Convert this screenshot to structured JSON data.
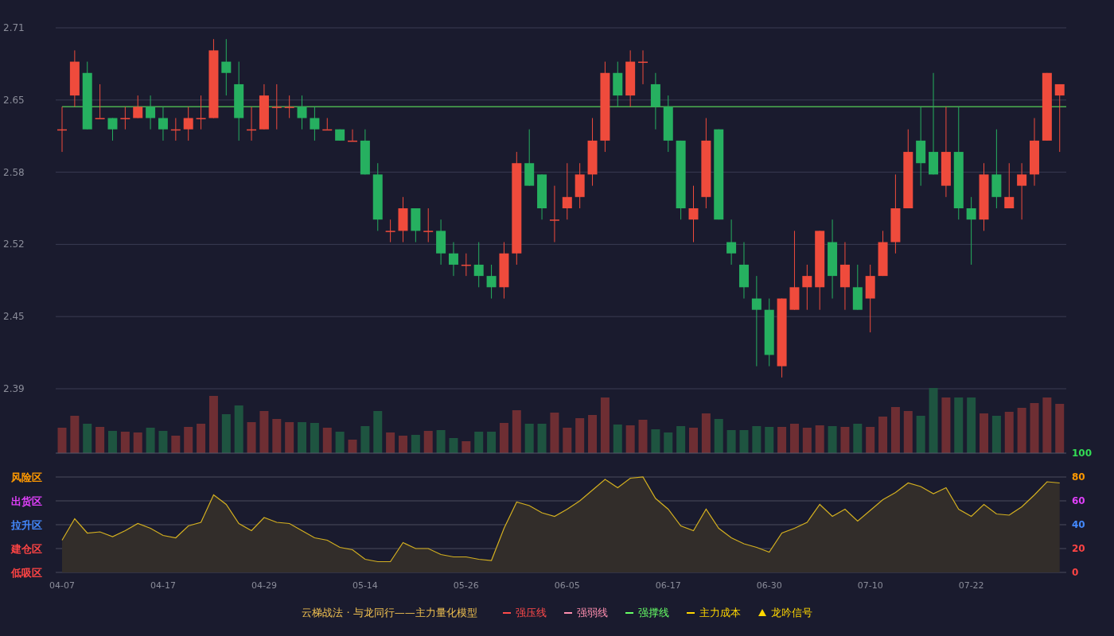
{
  "price_chart": {
    "chart_data": {
      "type": "candlestick",
      "grid": true,
      "ylim": [
        2.39,
        2.71
      ],
      "yticks": [
        {
          "value": 2.71,
          "label": "2.71"
        },
        {
          "value": 2.646,
          "label": "2.65"
        },
        {
          "value": 2.582,
          "label": "2.58"
        },
        {
          "value": 2.518,
          "label": "2.52"
        },
        {
          "value": 2.454,
          "label": "2.45"
        },
        {
          "value": 2.39,
          "label": "2.39"
        }
      ],
      "categories": [
        null,
        null,
        null,
        null,
        null,
        null,
        null,
        null,
        null,
        null,
        null,
        null,
        null,
        null,
        null,
        null,
        null,
        null,
        null,
        null,
        null,
        null,
        null,
        null,
        null,
        null,
        null,
        null,
        null,
        null,
        null,
        null,
        null,
        null,
        null,
        null,
        null,
        null,
        null,
        null,
        null,
        null,
        null,
        null,
        null,
        null,
        null,
        null,
        null,
        null,
        null,
        null,
        null,
        null,
        null,
        null,
        null,
        null,
        null,
        null,
        null,
        null,
        null,
        null,
        null,
        null,
        null,
        null,
        null,
        null,
        null,
        null,
        null,
        null,
        null,
        null,
        null,
        null,
        null,
        null
      ],
      "ohlc": [
        [
          2.62,
          2.64,
          2.6,
          2.62
        ],
        [
          2.65,
          2.69,
          2.64,
          2.68
        ],
        [
          2.67,
          2.68,
          2.62,
          2.62
        ],
        [
          2.63,
          2.66,
          2.63,
          2.63
        ],
        [
          2.63,
          2.63,
          2.61,
          2.62
        ],
        [
          2.63,
          2.64,
          2.62,
          2.63
        ],
        [
          2.63,
          2.65,
          2.63,
          2.64
        ],
        [
          2.64,
          2.65,
          2.62,
          2.63
        ],
        [
          2.63,
          2.64,
          2.61,
          2.62
        ],
        [
          2.62,
          2.63,
          2.61,
          2.62
        ],
        [
          2.62,
          2.64,
          2.61,
          2.63
        ],
        [
          2.63,
          2.65,
          2.62,
          2.63
        ],
        [
          2.63,
          2.7,
          2.63,
          2.69
        ],
        [
          2.68,
          2.7,
          2.65,
          2.67
        ],
        [
          2.66,
          2.68,
          2.61,
          2.63
        ],
        [
          2.62,
          2.64,
          2.61,
          2.62
        ],
        [
          2.62,
          2.66,
          2.62,
          2.65
        ],
        [
          2.64,
          2.66,
          2.62,
          2.64
        ],
        [
          2.64,
          2.65,
          2.63,
          2.64
        ],
        [
          2.64,
          2.65,
          2.62,
          2.63
        ],
        [
          2.63,
          2.64,
          2.61,
          2.62
        ],
        [
          2.62,
          2.63,
          2.62,
          2.62
        ],
        [
          2.62,
          2.62,
          2.61,
          2.61
        ],
        [
          2.61,
          2.62,
          2.61,
          2.61
        ],
        [
          2.61,
          2.62,
          2.58,
          2.58
        ],
        [
          2.58,
          2.59,
          2.53,
          2.54
        ],
        [
          2.53,
          2.54,
          2.52,
          2.53
        ],
        [
          2.53,
          2.56,
          2.52,
          2.55
        ],
        [
          2.55,
          2.55,
          2.52,
          2.53
        ],
        [
          2.53,
          2.55,
          2.52,
          2.53
        ],
        [
          2.53,
          2.54,
          2.5,
          2.51
        ],
        [
          2.51,
          2.52,
          2.49,
          2.5
        ],
        [
          2.5,
          2.51,
          2.49,
          2.5
        ],
        [
          2.5,
          2.52,
          2.48,
          2.49
        ],
        [
          2.49,
          2.5,
          2.47,
          2.48
        ],
        [
          2.48,
          2.52,
          2.47,
          2.51
        ],
        [
          2.51,
          2.6,
          2.5,
          2.59
        ],
        [
          2.59,
          2.62,
          2.57,
          2.57
        ],
        [
          2.58,
          2.58,
          2.54,
          2.55
        ],
        [
          2.54,
          2.57,
          2.52,
          2.54
        ],
        [
          2.55,
          2.59,
          2.54,
          2.56
        ],
        [
          2.56,
          2.59,
          2.55,
          2.58
        ],
        [
          2.58,
          2.63,
          2.57,
          2.61
        ],
        [
          2.61,
          2.68,
          2.6,
          2.67
        ],
        [
          2.67,
          2.68,
          2.64,
          2.65
        ],
        [
          2.65,
          2.69,
          2.64,
          2.68
        ],
        [
          2.68,
          2.69,
          2.66,
          2.68
        ],
        [
          2.66,
          2.67,
          2.62,
          2.64
        ],
        [
          2.64,
          2.65,
          2.6,
          2.61
        ],
        [
          2.61,
          2.61,
          2.54,
          2.55
        ],
        [
          2.54,
          2.57,
          2.52,
          2.55
        ],
        [
          2.56,
          2.63,
          2.55,
          2.61
        ],
        [
          2.62,
          2.62,
          2.54,
          2.54
        ],
        [
          2.52,
          2.54,
          2.5,
          2.51
        ],
        [
          2.5,
          2.52,
          2.47,
          2.48
        ],
        [
          2.47,
          2.49,
          2.41,
          2.46
        ],
        [
          2.46,
          2.47,
          2.41,
          2.42
        ],
        [
          2.41,
          2.47,
          2.4,
          2.47
        ],
        [
          2.46,
          2.53,
          2.46,
          2.48
        ],
        [
          2.48,
          2.5,
          2.46,
          2.49
        ],
        [
          2.48,
          2.53,
          2.46,
          2.53
        ],
        [
          2.52,
          2.54,
          2.47,
          2.49
        ],
        [
          2.48,
          2.52,
          2.46,
          2.5
        ],
        [
          2.48,
          2.5,
          2.46,
          2.46
        ],
        [
          2.47,
          2.5,
          2.44,
          2.49
        ],
        [
          2.49,
          2.53,
          2.49,
          2.52
        ],
        [
          2.52,
          2.58,
          2.51,
          2.55
        ],
        [
          2.55,
          2.62,
          2.55,
          2.6
        ],
        [
          2.61,
          2.64,
          2.57,
          2.59
        ],
        [
          2.6,
          2.67,
          2.58,
          2.58
        ],
        [
          2.57,
          2.64,
          2.56,
          2.6
        ],
        [
          2.6,
          2.64,
          2.54,
          2.55
        ],
        [
          2.55,
          2.56,
          2.5,
          2.54
        ],
        [
          2.54,
          2.59,
          2.53,
          2.58
        ],
        [
          2.58,
          2.62,
          2.55,
          2.56
        ],
        [
          2.55,
          2.59,
          2.55,
          2.56
        ],
        [
          2.57,
          2.59,
          2.54,
          2.58
        ],
        [
          2.58,
          2.63,
          2.57,
          2.61
        ],
        [
          2.61,
          2.67,
          2.61,
          2.67
        ],
        [
          2.65,
          2.66,
          2.6,
          2.66
        ]
      ],
      "ref_lines": [
        {
          "axis": "y",
          "value": 2.64,
          "color": "#4caf50"
        }
      ]
    }
  },
  "oscillator": {
    "zones": [
      {
        "label": "风险区",
        "color": "#ff9900"
      },
      {
        "label": "出货区",
        "color": "#e040fb"
      },
      {
        "label": "拉升区",
        "color": "#448aff"
      },
      {
        "label": "建仓区",
        "color": "#ff4444"
      },
      {
        "label": "低吸区",
        "color": "#ff4444"
      }
    ],
    "tick_styles": [
      {
        "color": "#33dd55"
      },
      {
        "color": "#ff9900"
      },
      {
        "color": "#e040fb"
      },
      {
        "color": "#448aff"
      },
      {
        "color": "#ff4444"
      },
      {
        "color": "#ff4444"
      }
    ],
    "chart_data": {
      "type": "area",
      "grid": true,
      "ylim": [
        0,
        100
      ],
      "yticks": [
        100,
        80,
        60,
        40,
        20,
        0
      ],
      "categories": [
        "04-07",
        null,
        null,
        null,
        null,
        null,
        null,
        null,
        "04-17",
        null,
        null,
        null,
        null,
        null,
        null,
        null,
        "04-29",
        null,
        null,
        null,
        null,
        null,
        null,
        null,
        "05-14",
        null,
        null,
        null,
        null,
        null,
        null,
        null,
        "05-26",
        null,
        null,
        null,
        null,
        null,
        null,
        null,
        "06-05",
        null,
        null,
        null,
        null,
        null,
        null,
        null,
        "06-17",
        null,
        null,
        null,
        null,
        null,
        null,
        null,
        "06-30",
        null,
        null,
        null,
        null,
        null,
        null,
        null,
        "07-10",
        null,
        null,
        null,
        null,
        null,
        null,
        null,
        "07-22",
        null,
        null,
        null,
        null,
        null,
        null,
        null
      ],
      "series": [
        {
          "color": "#d4b020",
          "values": [
            27,
            45,
            33,
            34,
            30,
            35,
            41,
            37,
            31,
            29,
            39,
            42,
            65,
            57,
            41,
            35,
            46,
            42,
            41,
            35,
            29,
            27,
            21,
            19,
            11,
            9,
            9,
            25,
            20,
            20,
            15,
            13,
            13,
            11,
            10,
            37,
            59,
            56,
            50,
            47,
            53,
            60,
            69,
            78,
            71,
            79,
            80,
            62,
            53,
            39,
            35,
            53,
            37,
            29,
            24,
            21,
            17,
            33,
            37,
            42,
            57,
            47,
            53,
            43,
            52,
            61,
            67,
            75,
            72,
            66,
            71,
            53,
            47,
            57,
            49,
            48,
            55,
            65,
            76,
            75
          ]
        }
      ]
    }
  },
  "legend": {
    "title": "云梯战法 · 与龙同行——主力量化模型",
    "items": [
      {
        "kind": "solid",
        "label": "强压线",
        "color": "#ff4a4a"
      },
      {
        "kind": "dashed",
        "label": "强弱线",
        "color": "#ff8fb0"
      },
      {
        "kind": "solid",
        "label": "强撑线",
        "color": "#66ff66"
      },
      {
        "kind": "dashed",
        "label": "主力成本",
        "color": "#ffd700"
      },
      {
        "kind": "triangle",
        "label": "龙吟信号",
        "color": "#ffd700"
      }
    ]
  }
}
